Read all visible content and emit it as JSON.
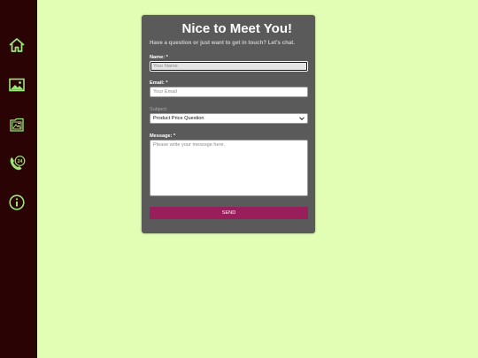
{
  "sidebar": {
    "items": [
      {
        "icon": "home-icon"
      },
      {
        "icon": "image-icon"
      },
      {
        "icon": "gallery-icon"
      },
      {
        "icon": "phone-24-icon",
        "badge": "24"
      },
      {
        "icon": "info-icon"
      }
    ],
    "icon_color": "#9be67a",
    "background": "#2a0305"
  },
  "form": {
    "title": "Nice to Meet You!",
    "subtitle": "Have a question or just want to get in touch? Let's chat.",
    "name_label": "Name: *",
    "name_placeholder": "Your Name",
    "email_label": "Email: *",
    "email_placeholder": "Your Email",
    "subject_label": "Subject:",
    "subject_value": "Product Price Question",
    "message_label": "Message: *",
    "message_placeholder": "Please write your messsge here.",
    "send_label": "SEND",
    "send_color": "#981e5c",
    "card_color": "#5a5a5a"
  },
  "page": {
    "background": "#e2fdb4"
  }
}
